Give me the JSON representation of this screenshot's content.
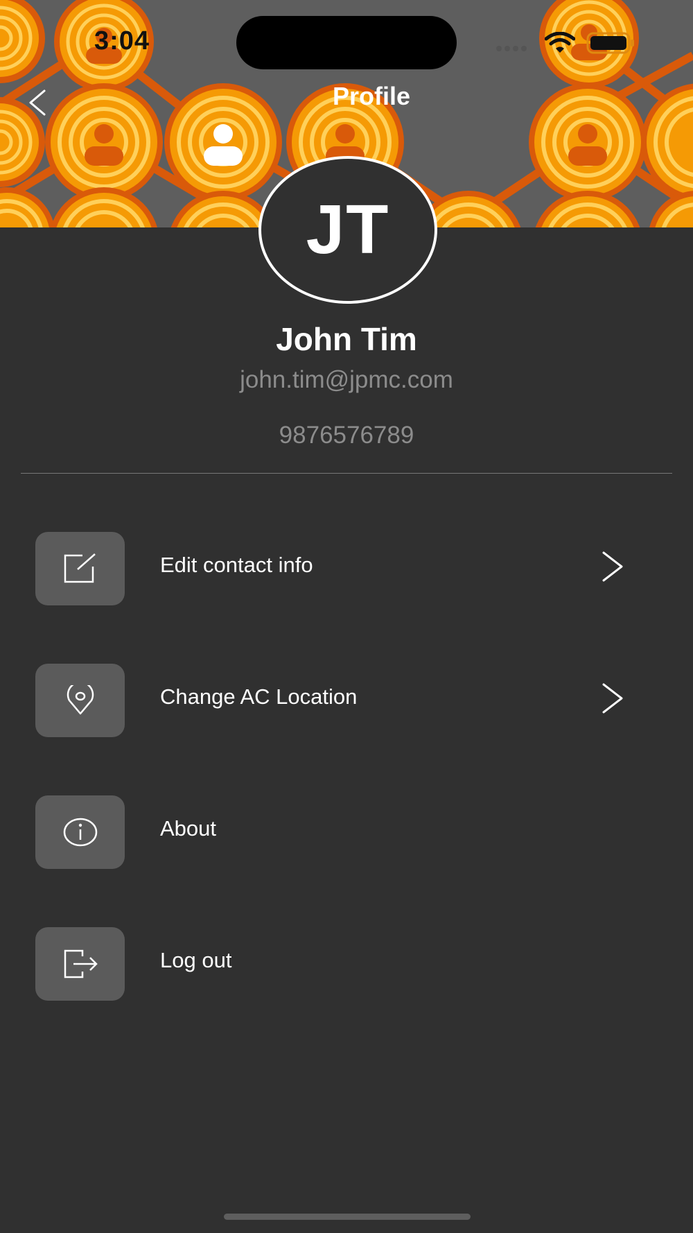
{
  "status_bar": {
    "time": "3:04"
  },
  "nav": {
    "title": "Profile"
  },
  "profile": {
    "initials": "JT",
    "name": "John Tim",
    "email": "john.tim@jpmc.com",
    "phone": "9876576789"
  },
  "menu": [
    {
      "label": "Edit contact info",
      "icon": "edit-icon",
      "has_chevron": true
    },
    {
      "label": "Change AC Location",
      "icon": "location-pin-icon",
      "has_chevron": true
    },
    {
      "label": "About",
      "icon": "info-icon",
      "has_chevron": false
    },
    {
      "label": "Log out",
      "icon": "logout-icon",
      "has_chevron": false
    }
  ],
  "colors": {
    "background": "#303030",
    "header_gray": "#5e5e5e",
    "pattern_orange": "#f59a05",
    "pattern_accent": "#d95a0a",
    "icon_box": "#5b5b5b",
    "secondary_text": "#8c8c8c"
  }
}
